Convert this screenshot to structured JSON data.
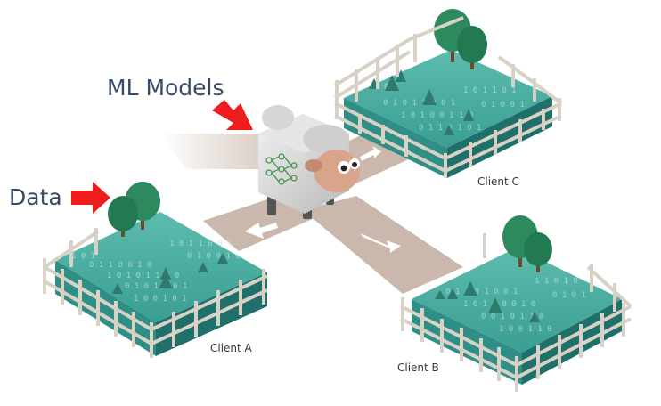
{
  "labels": {
    "ml_models": "ML Models",
    "data": "Data",
    "client_a": "Client A",
    "client_b": "Client B",
    "client_c": "Client C"
  },
  "colors": {
    "grass_top": "#4fb0a2",
    "grass_side": "#2f8f86",
    "soil": "#1f6f6a",
    "arrow_red": "#ee1c1c",
    "path": "#c9b8ab",
    "fence": "#f3eee6",
    "label_dark": "#3a4a66"
  },
  "icons": [
    "sheep-icon",
    "neural-network-icon",
    "red-arrow-icon",
    "white-arrow-icon",
    "tree-icon",
    "fence-icon"
  ]
}
